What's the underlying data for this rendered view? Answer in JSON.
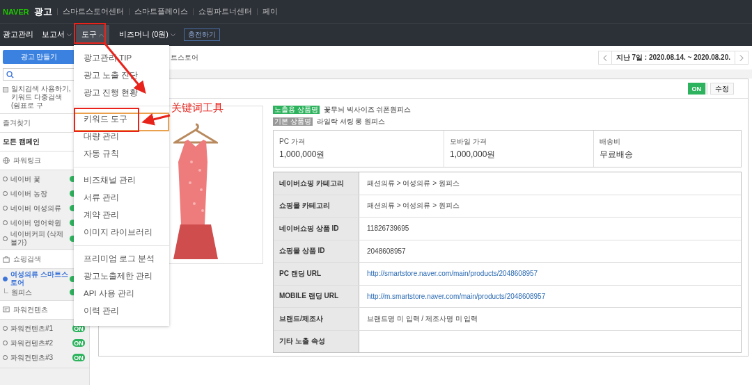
{
  "top_bar": {
    "logo": "NAVER",
    "product": "광고",
    "links": [
      "스마트스토어센터",
      "스마트플레이스",
      "쇼핑파트너센터",
      "페이"
    ]
  },
  "nav": {
    "items": [
      {
        "label": "광고관리",
        "dropdown": false,
        "selected": false
      },
      {
        "label": "보고서",
        "dropdown": true,
        "selected": false
      },
      {
        "label": "도구",
        "dropdown": true,
        "selected": true
      },
      {
        "label": "비즈머니 (0원)",
        "dropdown": true,
        "selected": false
      }
    ],
    "charge_button": "충전하기"
  },
  "tools_menu": {
    "groups": [
      [
        "광고관리 TIP",
        "광고 노출 진단",
        "광고 진행 현황"
      ],
      [
        "키워드 도구",
        "대량 관리",
        "자동 규칙"
      ],
      [
        "비즈채널 관리",
        "서류 관리",
        "계약 관리",
        "이미지 라이브러리"
      ],
      [
        "프리미엄 로그 분석",
        "광고노출제한 관리",
        "API 사용 관리",
        "이력 관리"
      ]
    ]
  },
  "sidebar": {
    "create_button": "광고 만들기",
    "exact_match": {
      "checked": false,
      "label": "일치검색 사용하기,",
      "hint": "키워드 다중검색(쉼표로 구"
    },
    "favorites": "즐겨찾기",
    "all_campaigns": "모든 캠페인",
    "sections": [
      {
        "title": "파워링크",
        "kind": "globe",
        "campaigns": [
          {
            "name": "네이버 꽃",
            "on": true,
            "selected": false
          },
          {
            "name": "네이버 농장",
            "on": true,
            "selected": false
          },
          {
            "name": "네이버 여성의류",
            "on": true,
            "selected": false
          },
          {
            "name": "네이버 영어학원",
            "on": true,
            "selected": false
          },
          {
            "name": "네이버커피 (삭제불가)",
            "on": true,
            "selected": false
          }
        ]
      },
      {
        "title": "쇼핑검색",
        "kind": "bag",
        "campaigns": [
          {
            "name": "여성의류 스마트스토어",
            "on": true,
            "selected": true,
            "children": [
              {
                "name": "원피스",
                "on": true
              }
            ]
          }
        ]
      },
      {
        "title": "파워컨텐츠",
        "kind": "note",
        "campaigns": [
          {
            "name": "파워컨텐츠#1",
            "on": true,
            "badge": "ON",
            "selected": false
          },
          {
            "name": "파워컨텐츠#2",
            "on": true,
            "badge": "ON",
            "selected": false
          },
          {
            "name": "파워컨텐츠#3",
            "on": true,
            "badge": "ON",
            "selected": false
          }
        ]
      }
    ]
  },
  "breadcrumb": "트스토어",
  "date_range": {
    "label": "지난 7일 : 2020.08.14. ~ 2020.08.20."
  },
  "product": {
    "on": true,
    "toggle_label": "ON",
    "edit_button": "수정",
    "display_name_tag": "노출용 상품명",
    "display_name": "꽃무늬 빅사이즈 쉬폰원피스",
    "base_name_tag": "기본 상품명",
    "base_name": "라일락 셔링 롱 원피스",
    "prices": [
      {
        "label": "PC 가격",
        "value": "1,000,000원"
      },
      {
        "label": "모바일 가격",
        "value": "1,000,000원"
      },
      {
        "label": "배송비",
        "value": "무료배송"
      }
    ],
    "details": [
      {
        "label": "네이버쇼핑 카테고리",
        "value": "패션의류 > 여성의류 > 원피스",
        "kind": "text"
      },
      {
        "label": "쇼핑몰 카테고리",
        "value": "패션의류 > 여성의류 > 원피스",
        "kind": "text"
      },
      {
        "label": "네이버쇼핑 상품 ID",
        "value": "11826739695",
        "kind": "text"
      },
      {
        "label": "쇼핑몰 상품 ID",
        "value": "2048608957",
        "kind": "text"
      },
      {
        "label": "PC 랜딩 URL",
        "value": "http://smartstore.naver.com/main/products/2048608957",
        "kind": "link"
      },
      {
        "label": "MOBILE 랜딩 URL",
        "value": "http://m.smartstore.naver.com/main/products/2048608957",
        "kind": "link"
      },
      {
        "label": "브랜드/제조사",
        "value": "브랜드명 미 입력 / 제조사명 미 입력",
        "kind": "text"
      },
      {
        "label": "기타 노출 속성",
        "kind": "text"
      }
    ]
  },
  "annotation": {
    "text": "关键词工具"
  }
}
